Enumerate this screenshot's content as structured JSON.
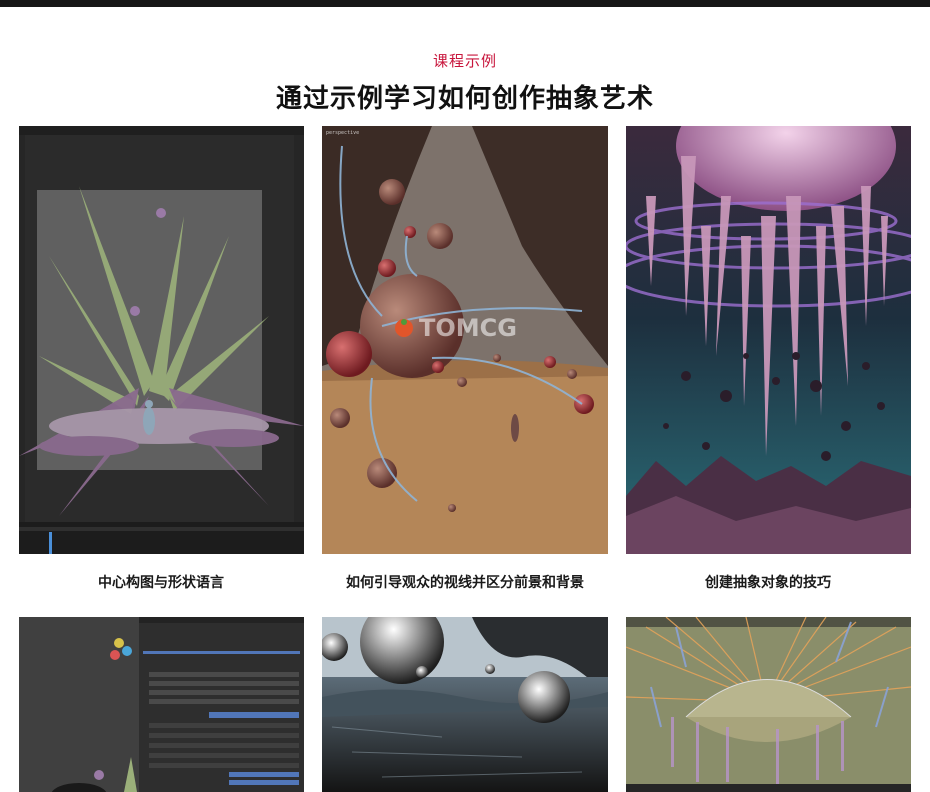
{
  "section": {
    "eyebrow": "课程示例",
    "title": "通过示例学习如何创作抽象艺术"
  },
  "cards": [
    {
      "caption": "中心构图与形状语言",
      "image": "blender-viewport-spiky-scene"
    },
    {
      "caption": "如何引导观众的视线并区分前景和背景",
      "image": "composition-sketch-spheres-cave",
      "watermark": "TOMCG"
    },
    {
      "caption": "创建抽象对象的技巧",
      "image": "abstract-crystal-render"
    },
    {
      "caption": "",
      "image": "blender-modifier-panel"
    },
    {
      "caption": "",
      "image": "chrome-spheres-rocky-render"
    },
    {
      "caption": "",
      "image": "geometry-nodes-dome-viewport"
    }
  ],
  "colors": {
    "accent": "#c8163c",
    "topbar": "#161616"
  }
}
